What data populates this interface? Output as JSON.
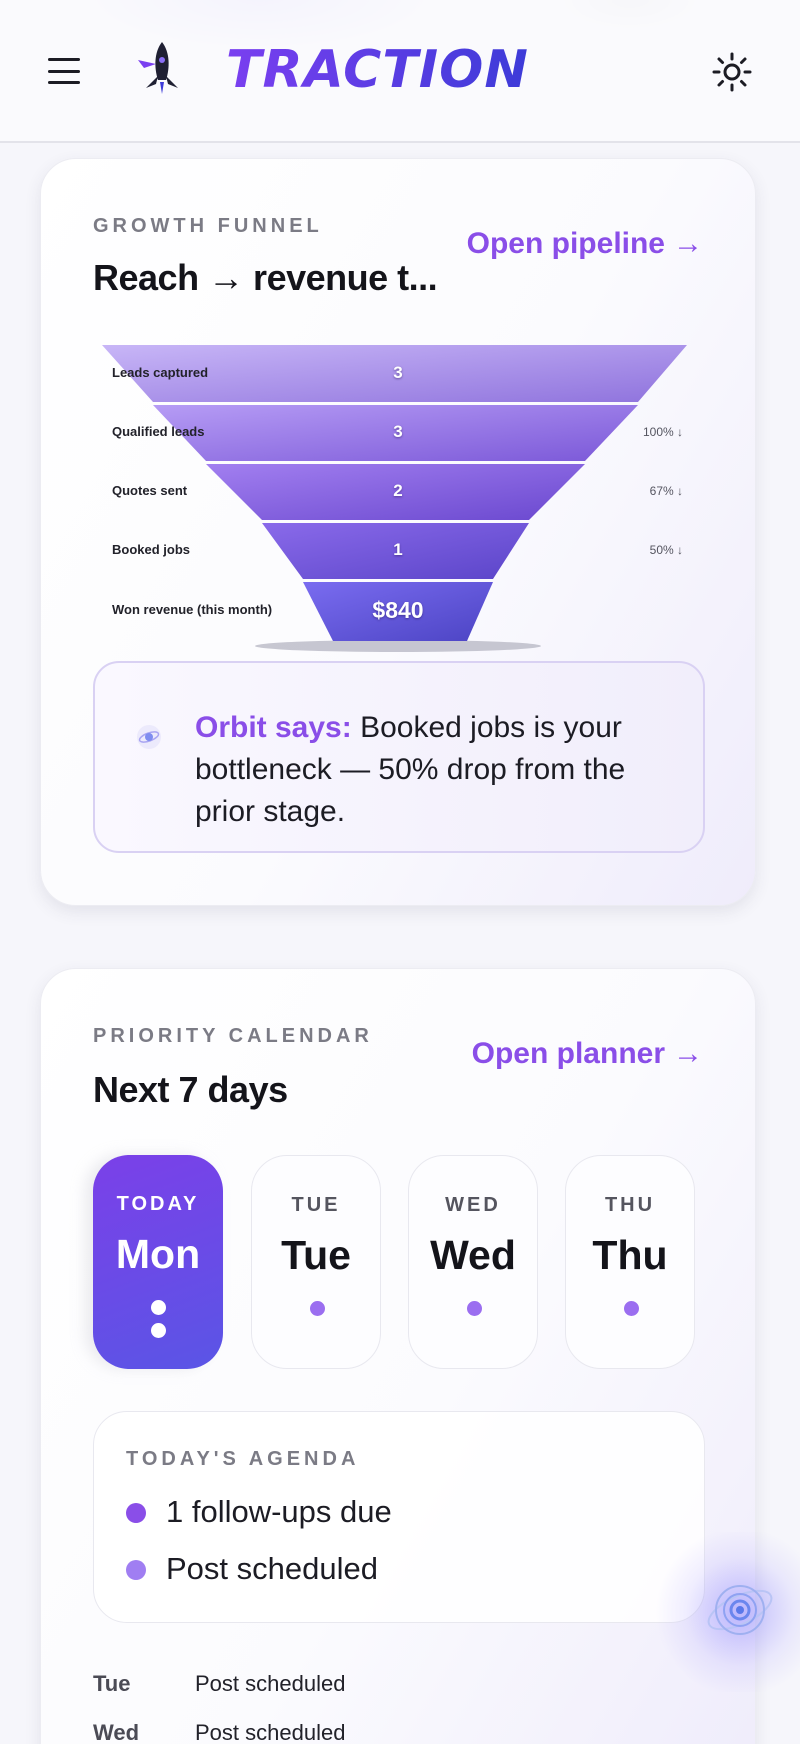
{
  "header": {
    "brand": "TRACTION",
    "menu_icon": "hamburger-menu-icon",
    "logo_icon": "rocket-logo-icon",
    "theme_icon": "sun-icon"
  },
  "funnel_card": {
    "eyebrow": "GROWTH FUNNEL",
    "title": "Reach → revenue t...",
    "link_label": "Open pipeline",
    "link_arrow": "→",
    "stages": [
      {
        "label": "Leads captured",
        "value": "3",
        "pct": ""
      },
      {
        "label": "Qualified leads",
        "value": "3",
        "pct": "100% ↓"
      },
      {
        "label": "Quotes sent",
        "value": "2",
        "pct": "67% ↓"
      },
      {
        "label": "Booked jobs",
        "value": "1",
        "pct": "50% ↓"
      },
      {
        "label": "Won revenue (this month)",
        "value": "$840",
        "pct": ""
      }
    ],
    "orbit": {
      "prefix": "Orbit says:",
      "message": " Booked jobs is your bottleneck — 50% drop from the prior stage."
    }
  },
  "calendar_card": {
    "eyebrow": "PRIORITY CALENDAR",
    "title": "Next 7 days",
    "link_label": "Open planner",
    "link_arrow": "→",
    "days": [
      {
        "small": "TODAY",
        "big": "Mon"
      },
      {
        "small": "TUE",
        "big": "Tue"
      },
      {
        "small": "WED",
        "big": "Wed"
      },
      {
        "small": "THU",
        "big": "Thu"
      }
    ],
    "agenda": {
      "eyebrow": "TODAY'S AGENDA",
      "items": [
        {
          "text": "1 follow-ups due",
          "color": "#8a4ee8"
        },
        {
          "text": "Post scheduled",
          "color": "#a07ef2"
        }
      ]
    },
    "week": [
      {
        "day": "Tue",
        "text": "Post scheduled"
      },
      {
        "day": "Wed",
        "text": "Post scheduled"
      }
    ]
  },
  "colors": {
    "accent": "#8a4ee8",
    "brand_gradient_start": "#7a3ff0",
    "brand_gradient_end": "#3d3bd8"
  }
}
